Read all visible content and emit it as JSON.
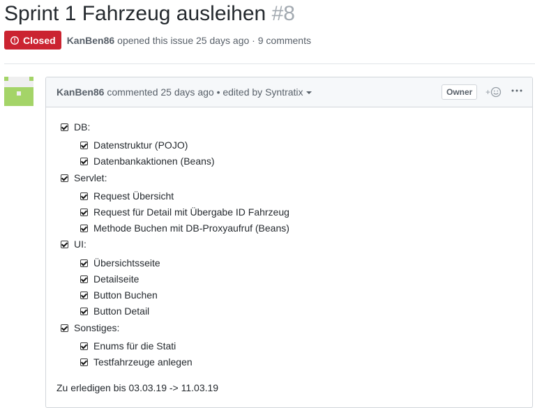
{
  "issue": {
    "title": "Sprint 1 Fahrzeug ausleihen",
    "number": "#8",
    "state_label": "Closed",
    "author": "KanBen86",
    "opened_text": "opened this issue 25 days ago · 9 comments"
  },
  "comment": {
    "author": "KanBen86",
    "header_text": "commented 25 days ago • edited by Syntratix",
    "owner_label": "Owner",
    "reaction_icon": "smiley-add-icon",
    "more_icon": "kebab-icon",
    "tasks": [
      {
        "label": "DB:",
        "checked": true,
        "level": 0
      },
      {
        "label": "Datenstruktur (POJO)",
        "checked": true,
        "level": 1
      },
      {
        "label": "Datenbankaktionen (Beans)",
        "checked": true,
        "level": 1
      },
      {
        "label": "Servlet:",
        "checked": true,
        "level": 0
      },
      {
        "label": "Request Übersicht",
        "checked": true,
        "level": 1
      },
      {
        "label": "Request für Detail mit Übergabe ID Fahrzeug",
        "checked": true,
        "level": 1
      },
      {
        "label": "Methode Buchen mit DB-Proxyaufruf (Beans)",
        "checked": true,
        "level": 1
      },
      {
        "label": "UI:",
        "checked": true,
        "level": 0
      },
      {
        "label": "Übersichtsseite",
        "checked": true,
        "level": 1
      },
      {
        "label": "Detailseite",
        "checked": true,
        "level": 1
      },
      {
        "label": "Button Buchen",
        "checked": true,
        "level": 1
      },
      {
        "label": "Button Detail",
        "checked": true,
        "level": 1
      },
      {
        "label": "Sonstiges:",
        "checked": true,
        "level": 0
      },
      {
        "label": "Enums für die Stati",
        "checked": true,
        "level": 1
      },
      {
        "label": "Testfahrzeuge anlegen",
        "checked": true,
        "level": 1
      }
    ],
    "footer": "Zu erledigen bis 03.03.19 -> 11.03.19"
  },
  "colors": {
    "closed": "#cb2431",
    "avatar_green": "#a4d468"
  }
}
